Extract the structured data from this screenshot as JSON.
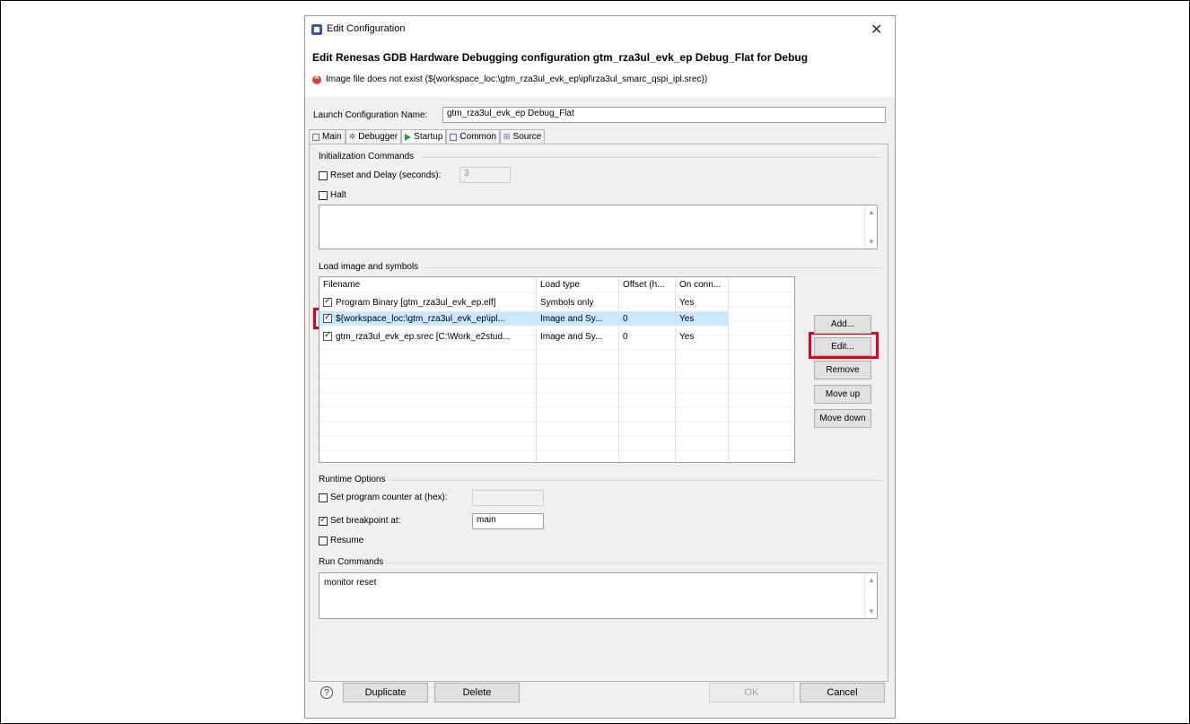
{
  "window": {
    "title": "Edit Configuration",
    "close_glyph": "✕"
  },
  "header": {
    "heading": "Edit Renesas GDB Hardware Debugging configuration gtm_rza3ul_evk_ep Debug_Flat for Debug",
    "error_message": "Image file does not exist (${workspace_loc:\\gtm_rza3ul_evk_ep\\ipl\\rza3ul_smarc_qspi_ipl.srec})"
  },
  "launch_config": {
    "label": "Launch Configuration Name:",
    "value": "gtm_rza3ul_evk_ep Debug_Flat"
  },
  "tabs": [
    {
      "label": "Main",
      "icon": "main-icon"
    },
    {
      "label": "Debugger",
      "icon": "debugger-icon"
    },
    {
      "label": "Startup",
      "icon": "startup-icon"
    },
    {
      "label": "Common",
      "icon": "common-icon"
    },
    {
      "label": "Source",
      "icon": "source-icon"
    }
  ],
  "active_tab": "Startup",
  "init_commands": {
    "title": "Initialization Commands",
    "reset_label": "Reset and Delay (seconds):",
    "reset_checked": false,
    "reset_value": "3",
    "halt_label": "Halt",
    "halt_checked": false,
    "commands_text": ""
  },
  "load_image": {
    "title": "Load image and symbols",
    "columns": [
      "Filename",
      "Load type",
      "Offset (h...",
      "On conn..."
    ],
    "rows": [
      {
        "checked": true,
        "filename": "Program Binary [gtm_rza3ul_evk_ep.elf]",
        "load_type": "Symbols only",
        "offset": "",
        "on_connect": "Yes"
      },
      {
        "checked": true,
        "filename": "${workspace_loc:\\gtm_rza3ul_evk_ep\\ipl...",
        "load_type": "Image and Sy...",
        "offset": "0",
        "on_connect": "Yes"
      },
      {
        "checked": true,
        "filename": "gtm_rza3ul_evk_ep.srec [C:\\Work_e2stud...",
        "load_type": "Image and Sy...",
        "offset": "0",
        "on_connect": "Yes"
      }
    ],
    "selected_row": 1,
    "buttons": {
      "add": "Add...",
      "edit": "Edit...",
      "remove": "Remove",
      "move_up": "Move up",
      "move_down": "Move down"
    }
  },
  "runtime_options": {
    "title": "Runtime Options",
    "pc_label": "Set program counter at (hex):",
    "pc_checked": false,
    "pc_value": "",
    "bp_label": "Set breakpoint at:",
    "bp_checked": true,
    "bp_value": "main",
    "resume_label": "Resume",
    "resume_checked": false
  },
  "run_commands": {
    "title": "Run Commands",
    "text": "monitor reset"
  },
  "footer": {
    "help_glyph": "?",
    "duplicate": "Duplicate",
    "delete": "Delete",
    "ok": "OK",
    "cancel": "Cancel"
  },
  "colors": {
    "highlight": "#e0001b",
    "selection": "#cce8ff"
  }
}
